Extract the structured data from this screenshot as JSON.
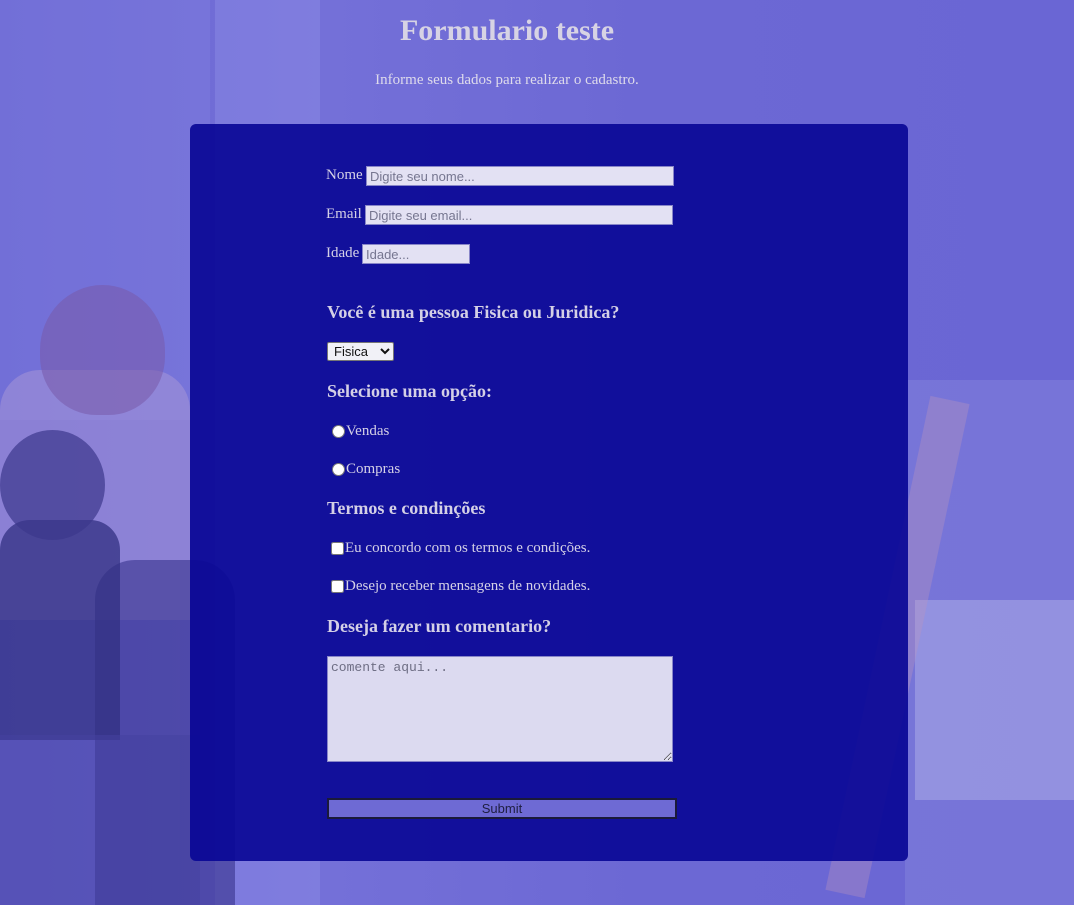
{
  "page": {
    "title": "Formulario teste",
    "subtitle": "Informe seus dados para realizar o cadastro."
  },
  "form": {
    "name": {
      "label": "Nome",
      "placeholder": "Digite seu nome...",
      "value": ""
    },
    "email": {
      "label": "Email",
      "placeholder": "Digite seu email...",
      "value": ""
    },
    "age": {
      "label": "Idade",
      "placeholder": "Idade...",
      "value": ""
    },
    "person_type": {
      "heading": "Você é uma pessoa Fisica ou Juridica?",
      "selected": "Fisica"
    },
    "option": {
      "heading": "Selecione uma opção:",
      "options": [
        {
          "label": "Vendas",
          "checked": false
        },
        {
          "label": "Compras",
          "checked": false
        }
      ]
    },
    "terms": {
      "heading": "Termos e condinções",
      "items": [
        {
          "label": "Eu concordo com os termos e condições.",
          "checked": false
        },
        {
          "label": "Desejo receber mensagens de novidades.",
          "checked": false
        }
      ]
    },
    "comment": {
      "heading": "Deseja fazer um comentario?",
      "placeholder": "comente aqui...",
      "value": ""
    },
    "submit_label": "Submit"
  },
  "icons": {
    "select_arrow": "chevron-down-icon"
  },
  "colors": {
    "card_background": "#0a0896",
    "page_background": "#6c68d4",
    "submit_background": "#6e6ad4",
    "text": "#d4d0e6"
  }
}
